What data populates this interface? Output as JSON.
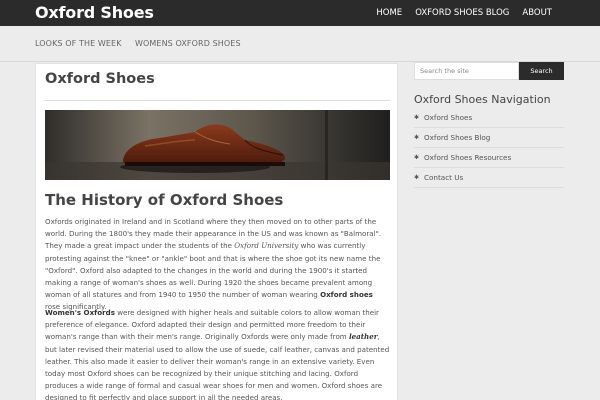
{
  "header": {
    "site_title": "Oxford Shoes",
    "nav": [
      "HOME",
      "OXFORD SHOES BLOG",
      "ABOUT"
    ]
  },
  "subnav": [
    "LOOKS OF THE WEEK",
    "WOMENS OXFORD SHOES"
  ],
  "main": {
    "title": "Oxford Shoes",
    "section_title": "The History of Oxford Shoes",
    "p1": {
      "a": "Oxfords originated in Ireland and in Scotland where they then moved on to other parts of the world. During the 1800's they made their appearance in the US and was known as \"Balmoral\". They made a great impact under the students of the ",
      "b": "Oxford University",
      "c": " who was currently protesting against the \"knee\" or \"ankle\" boot and that is where the shoe got its new name the \"Oxford\". Oxford also adapted to the changes in the world and during the 1900's it started making a range of woman's shoes as well. During 1920 the shoes became prevalent among woman of all statures and from 1940 to 1950 the number of woman wearing ",
      "d": "Oxford shoes",
      "e": " rose significantly."
    },
    "p2": {
      "a": "Women's Oxfords",
      "b": " were designed with higher heals and suitable colors to allow woman their preference of elegance. Oxford adapted their design and permitted more freedom to their woman's range than with their men's range. Originally Oxfords were only made from ",
      "c": "leather",
      "d": ", but later revised their material used to allow the use of suede, calf leather, canvas and patented leather. This also made it easier to deliver their woman's range in an extensive variety. Even today most Oxford shoes can be recognized by their unique stitching and lacing. Oxford produces a wide range of formal and casual wear shoes for men and women. Oxford shoes are designed to fit perfectly and place support in all the needed areas."
    }
  },
  "sidebar": {
    "search_placeholder": "Search the site",
    "search_button": "Search",
    "nav_title": "Oxford Shoes Navigation",
    "items": [
      "Oxford Shoes",
      "Oxford Shoes Blog",
      "Oxford Shoes Resources",
      "Contact Us"
    ]
  },
  "colors": {
    "topbar": "#2b2b2b",
    "background": "#ececec",
    "panel": "#ffffff",
    "shoe": "#6b2a15"
  }
}
